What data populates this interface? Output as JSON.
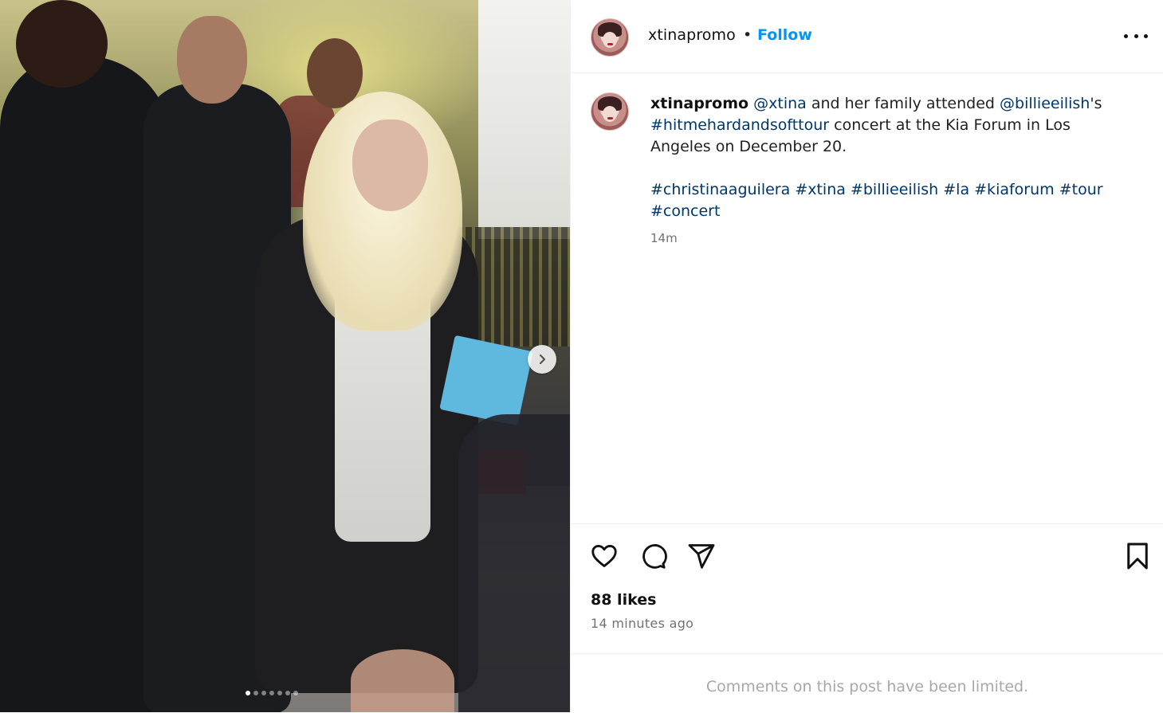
{
  "post": {
    "username": "xtinapromo",
    "separator": "•",
    "follow_label": "Follow",
    "more_icon": "more-options-icon"
  },
  "media": {
    "slide_count": 7,
    "active_slide": 1,
    "next_icon": "chevron-right-icon"
  },
  "caption": {
    "username": "xtinapromo",
    "mention_1": "@xtina",
    "text_1": " and her family attended ",
    "mention_2": "@billieeilish",
    "text_2": "'s ",
    "hashtag_tour": "#hitmehardandsofttour",
    "text_3": " concert at the Kia Forum in Los Angeles on December 20.",
    "hashtags": [
      "#christinaaguilera",
      "#xtina",
      "#billieeilish",
      "#la",
      "#kiaforum",
      "#tour",
      "#concert"
    ],
    "time": "14m"
  },
  "actions": {
    "like_icon": "heart-icon",
    "comment_icon": "comment-icon",
    "share_icon": "paper-plane-icon",
    "save_icon": "bookmark-icon"
  },
  "stats": {
    "likes": "88 likes",
    "posted": "14 minutes ago"
  },
  "comments": {
    "limited_text": "Comments on this post have been limited."
  }
}
